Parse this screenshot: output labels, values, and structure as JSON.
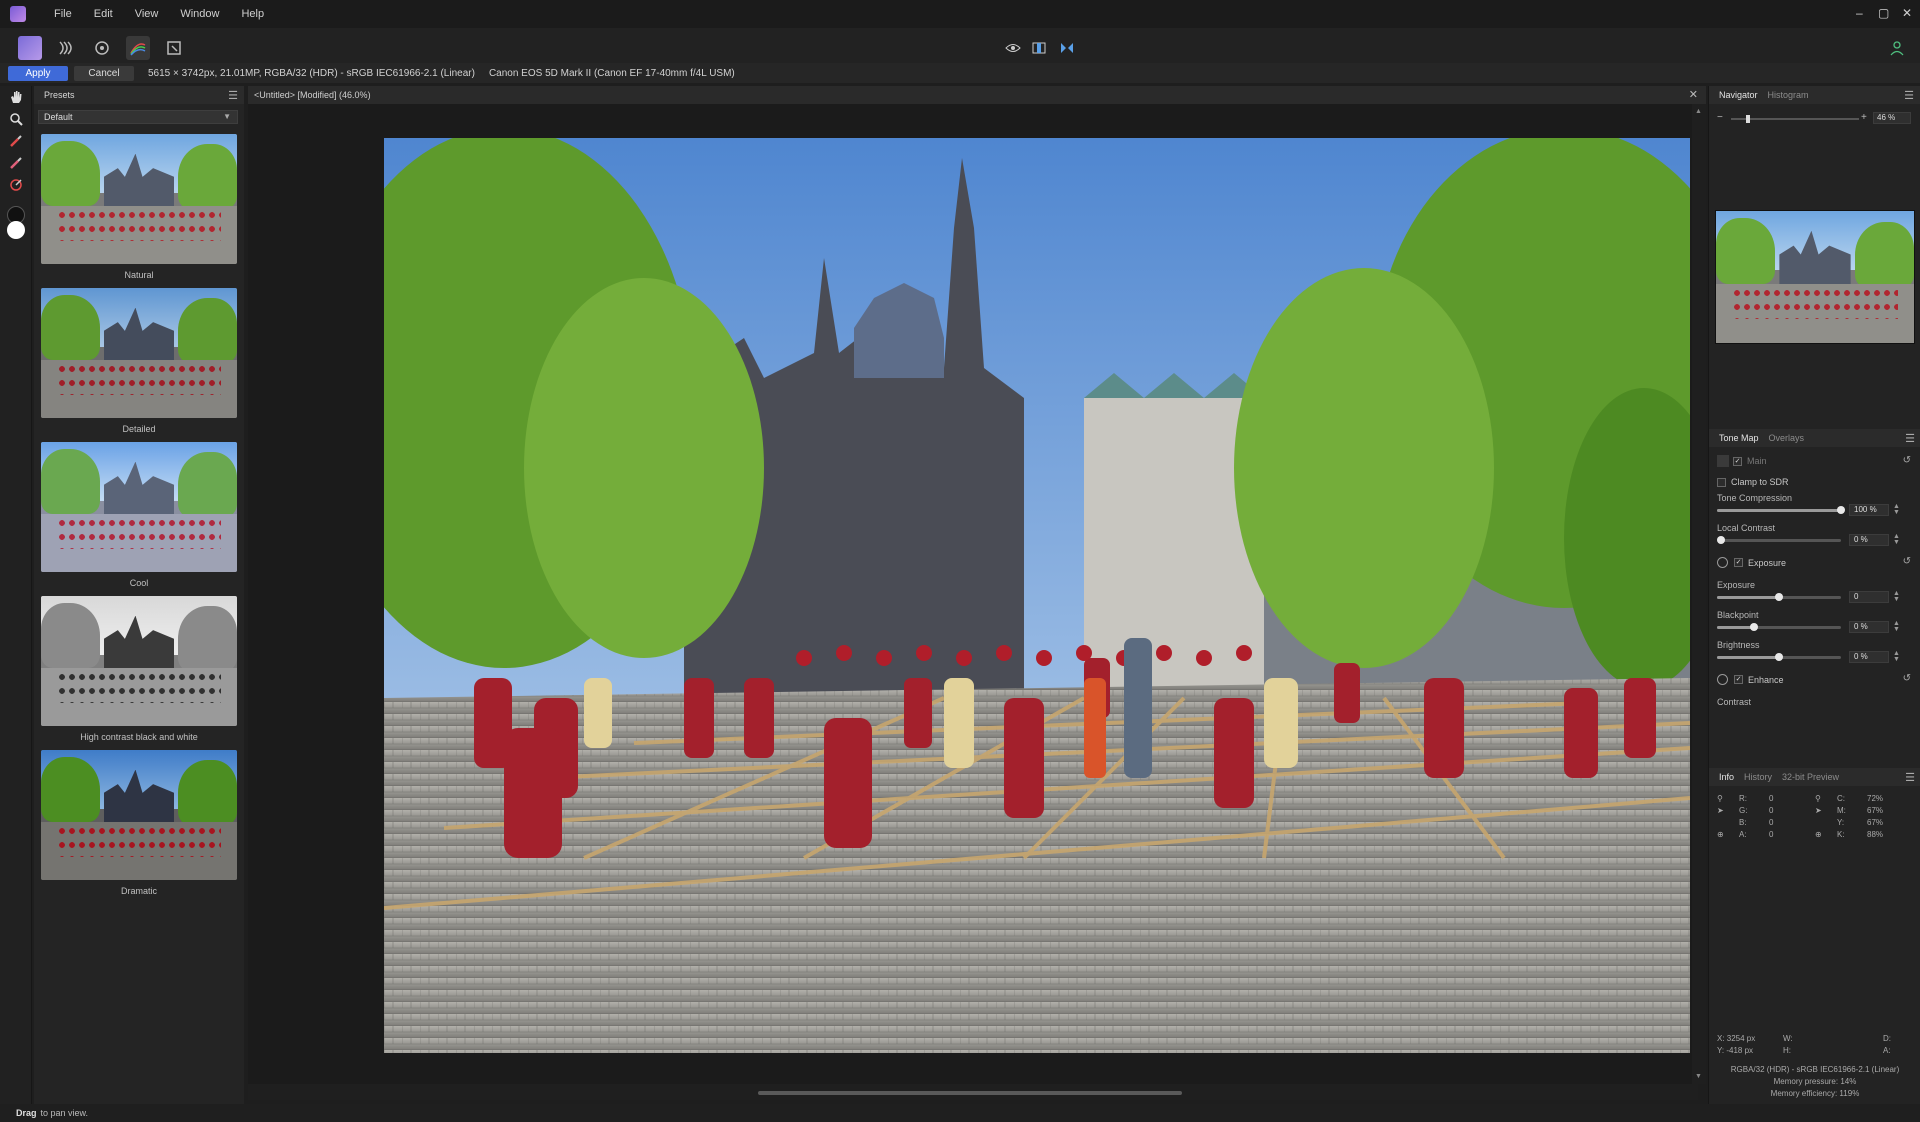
{
  "menu": {
    "items": [
      "File",
      "Edit",
      "View",
      "Window",
      "Help"
    ]
  },
  "window_controls": {
    "minimize": "–",
    "maximize": "▢",
    "close": "✕"
  },
  "context_bar": {
    "apply_label": "Apply",
    "cancel_label": "Cancel",
    "image_info": "5615 × 3742px, 21.01MP, RGBA/32 (HDR) - sRGB IEC61966-2.1 (Linear)",
    "camera_info": "Canon EOS 5D Mark II (Canon EF 17-40mm f/4L USM)"
  },
  "presets": {
    "panel_title": "Presets",
    "selected_category": "Default",
    "items": [
      {
        "label": "Natural"
      },
      {
        "label": "Detailed"
      },
      {
        "label": "Cool"
      },
      {
        "label": "High contrast black and white"
      },
      {
        "label": "Dramatic"
      }
    ]
  },
  "document": {
    "tab_title": "<Untitled> [Modified] (46.0%)"
  },
  "navigator": {
    "tabs": [
      "Navigator",
      "Histogram"
    ],
    "zoom_value": "46 %",
    "zoom_level": 0.46
  },
  "tonemap": {
    "tabs": [
      "Tone Map",
      "Overlays"
    ],
    "main_label": "Main",
    "clamp_label": "Clamp to SDR",
    "tone_compression": {
      "label": "Tone Compression",
      "value": "100 %",
      "level": 1.0
    },
    "local_contrast": {
      "label": "Local Contrast",
      "value": "0 %",
      "level": 0.0
    },
    "exposure_group": "Exposure",
    "exposure": {
      "label": "Exposure",
      "value": "0",
      "level": 0.5
    },
    "blackpoint": {
      "label": "Blackpoint",
      "value": "0 %",
      "level": 0.3
    },
    "brightness": {
      "label": "Brightness",
      "value": "0 %",
      "level": 0.5
    },
    "enhance_group": "Enhance",
    "contrast_label": "Contrast"
  },
  "info": {
    "tabs": [
      "Info",
      "History",
      "32-bit Preview"
    ],
    "rgb": [
      {
        "k": "R:",
        "v": "0"
      },
      {
        "k": "G:",
        "v": "0"
      },
      {
        "k": "B:",
        "v": "0"
      },
      {
        "k": "A:",
        "v": "0"
      }
    ],
    "cmyk": [
      {
        "k": "C:",
        "v": "72%"
      },
      {
        "k": "M:",
        "v": "67%"
      },
      {
        "k": "Y:",
        "v": "67%"
      },
      {
        "k": "K:",
        "v": "88%"
      }
    ],
    "x": "X: 3254 px",
    "y": "Y: -418 px",
    "w": "W:",
    "h": "H:",
    "d": "D:",
    "a": "A:",
    "color_profile": "RGBA/32 (HDR) - sRGB IEC61966-2.1 (Linear)",
    "memory_pressure": "Memory pressure: 14%",
    "memory_efficiency": "Memory efficiency: 119%"
  },
  "status": {
    "bold": "Drag",
    "text": "to pan view."
  },
  "colors": {
    "accent": "#3f6ad8",
    "sky": "#8fb9e8",
    "tree": "#6ea73a",
    "statue": "#a3202c",
    "cobble": "#8e8e8a"
  }
}
